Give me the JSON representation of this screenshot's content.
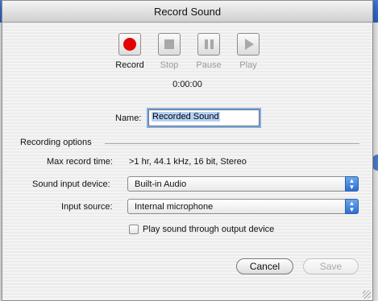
{
  "window": {
    "title": "Record Sound"
  },
  "toolbar": {
    "record_label": "Record",
    "stop_label": "Stop",
    "pause_label": "Pause",
    "play_label": "Play"
  },
  "timer": "0:00:00",
  "name_field": {
    "label": "Name:",
    "value": "Recorded Sound"
  },
  "recording_options": {
    "title": "Recording options",
    "max_time_label": "Max record time:",
    "max_time_value": ">1 hr, 44.1 kHz, 16 bit, Stereo",
    "input_device_label": "Sound input device:",
    "input_device_value": "Built-in Audio",
    "input_source_label": "Input source:",
    "input_source_value": "Internal microphone",
    "play_through_label": "Play sound through output device",
    "play_through_checked": false
  },
  "buttons": {
    "cancel": "Cancel",
    "save": "Save"
  },
  "colors": {
    "record_red": "#e40000",
    "popup_blue": "#2c6ed4",
    "focus_ring": "#7eaee6"
  }
}
